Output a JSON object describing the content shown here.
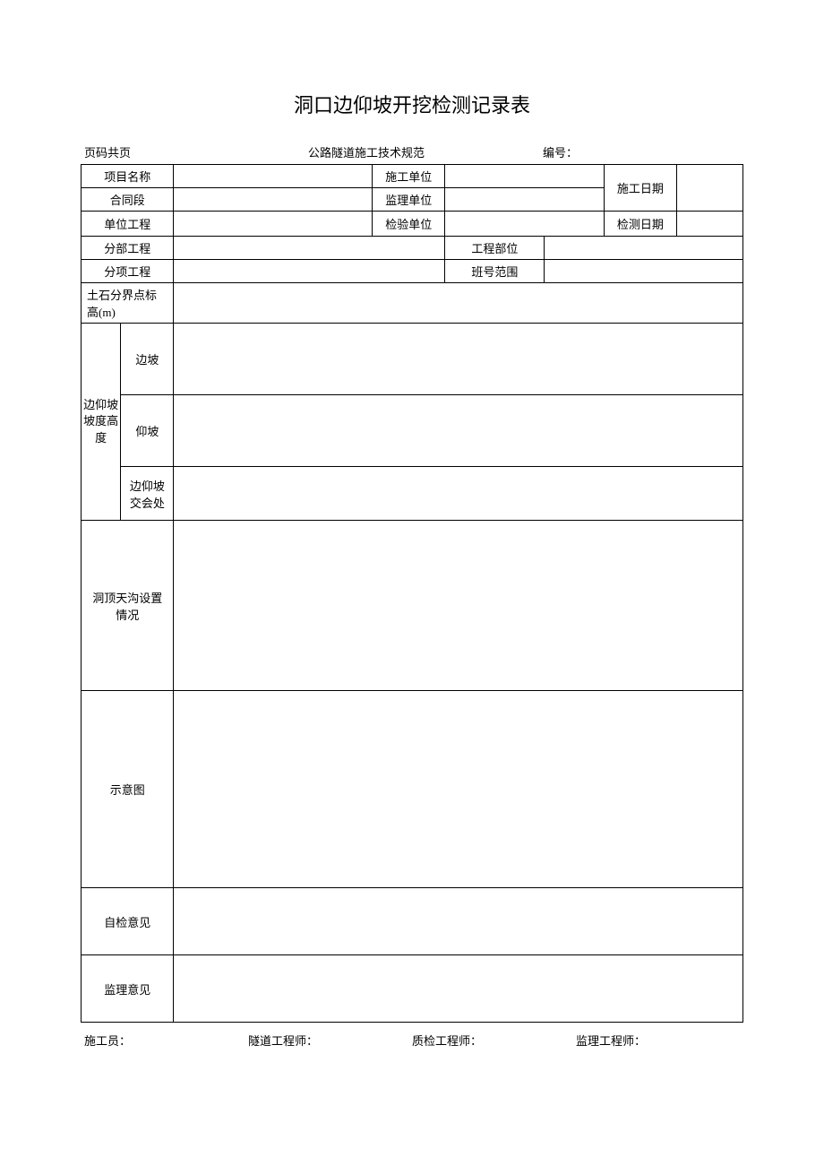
{
  "title": "洞口边仰坡开挖检测记录表",
  "header": {
    "page_label": "页码共页",
    "spec_label": "公路隧道施工技术规范",
    "number_label": "编号："
  },
  "rows": {
    "project_name": "项目名称",
    "contract_section": "合同段",
    "unit_project": "单位工程",
    "sub_project": "分部工程",
    "item_project": "分项工程",
    "construction_unit": "施工单位",
    "supervision_unit": "监理单位",
    "inspection_unit": "检验单位",
    "construction_date": "施工日期",
    "inspection_date": "检测日期",
    "project_part": "工程部位",
    "class_range": "班号范围",
    "boundary_elevation": "土石分界点标高(m)"
  },
  "slope": {
    "group_label": "边仰坡坡度高度",
    "side_slope": "边坡",
    "upward_slope": "仰坡",
    "intersection": "边仰坡交会处"
  },
  "sections": {
    "ditch": "洞顶天沟设置情况",
    "diagram": "示意图",
    "self_check": "自检意见",
    "supervision": "监理意见"
  },
  "footer": {
    "constructor": "施工员：",
    "tunnel_engineer": "隧道工程师：",
    "qc_engineer": "质检工程师：",
    "supervision_engineer": "监理工程师："
  }
}
